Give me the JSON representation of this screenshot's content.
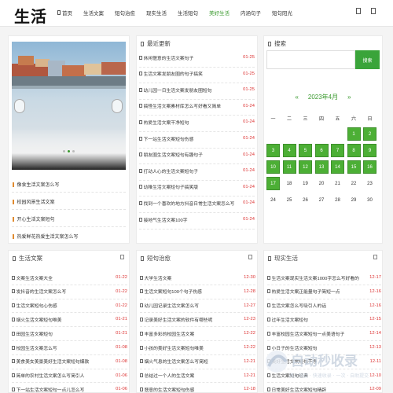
{
  "logo": "生活",
  "nav": [
    {
      "label": "首页",
      "active": false
    },
    {
      "label": "生活文案",
      "active": false
    },
    {
      "label": "短句治愈",
      "active": false
    },
    {
      "label": "现实生活",
      "active": false
    },
    {
      "label": "生活短句",
      "active": false
    },
    {
      "label": "美好生活",
      "active": true
    },
    {
      "label": "内涵句子",
      "active": false
    },
    {
      "label": "短句阳光",
      "active": false
    }
  ],
  "featured": [
    "像食生活文案怎么写",
    "校园风景生活文案",
    "开心生活文案短句",
    "热爱鲜花热爱生活文案怎么写"
  ],
  "latest": {
    "title": "最近更新",
    "rows": [
      {
        "t": "休闲惬意的生活文案句子",
        "d": "01-25"
      },
      {
        "t": "生活文案发朋友圈的句子搞笑",
        "d": "01-25"
      },
      {
        "t": "幼儿园一日生活文案发朋友圈短句",
        "d": "01-25"
      },
      {
        "t": "搞怪生活文案素材库怎么写好看又简单",
        "d": "01-24"
      },
      {
        "t": "热爱生活文案干净短句",
        "d": "01-24"
      },
      {
        "t": "下一站生活文案短句伤感",
        "d": "01-24"
      },
      {
        "t": "朋友圈生活文案短句有趣句子",
        "d": "01-24"
      },
      {
        "t": "打动人心的生活文案短句子",
        "d": "01-24"
      },
      {
        "t": "幼稚生活文案短句子搞笑版",
        "d": "01-24"
      },
      {
        "t": "找到一个喜欢的地方抖音日常生活文案怎么写",
        "d": "01-24"
      },
      {
        "t": "接地气生活文案100字",
        "d": "01-24"
      }
    ]
  },
  "search": {
    "title": "搜索",
    "placeholder": "",
    "button": "搜索"
  },
  "calendar": {
    "prev": "«",
    "title": "2023年4月",
    "next": "»",
    "weekdays": [
      "一",
      "二",
      "三",
      "四",
      "五",
      "六",
      "日"
    ],
    "weeks": [
      [
        "",
        "",
        "",
        "",
        "",
        "1",
        "2"
      ],
      [
        "3",
        "4",
        "5",
        "6",
        "7",
        "8",
        "9"
      ],
      [
        "10",
        "11",
        "12",
        "13",
        "14",
        "15",
        "16"
      ],
      [
        "17",
        "18",
        "19",
        "20",
        "21",
        "22",
        "23"
      ],
      [
        "24",
        "25",
        "26",
        "27",
        "28",
        "29",
        "30"
      ]
    ],
    "highlighted": [
      "1",
      "2",
      "3",
      "4",
      "5",
      "6",
      "7",
      "8",
      "9",
      "10",
      "11",
      "12",
      "13",
      "14",
      "15",
      "16",
      "17"
    ]
  },
  "col1": {
    "title": "生活文案",
    "rows": [
      {
        "t": "文案生活文案大全",
        "d": "01-22"
      },
      {
        "t": "发抖音的生活文案怎么写",
        "d": "01-22"
      },
      {
        "t": "生活文案短句心伤感",
        "d": "01-22"
      },
      {
        "t": "烟火生活文案短句唯美",
        "d": "01-21"
      },
      {
        "t": "田园生活文案短句",
        "d": "01-21"
      },
      {
        "t": "校园生活文案怎么写",
        "d": "01-08"
      },
      {
        "t": "美食美女美景美好生活文案短句爆款",
        "d": "01-08"
      },
      {
        "t": "简单的农村生活文案怎么写简引人",
        "d": "01-06"
      },
      {
        "t": "下一站生活文案短句一点儿怎么写",
        "d": "01-06"
      }
    ]
  },
  "col2": {
    "title": "短句治愈",
    "rows": [
      {
        "t": "大学生活文案",
        "d": "12-30"
      },
      {
        "t": "生活文案短句100个句子伤感",
        "d": "12-28"
      },
      {
        "t": "幼儿园记录生活文案怎么写",
        "d": "12-27"
      },
      {
        "t": "记录美好生活文案的软件有哪些呢",
        "d": "12-23"
      },
      {
        "t": "丰富多彩的校园生活文案",
        "d": "12-22"
      },
      {
        "t": "小孩的美好生活文案短句唯美",
        "d": "12-22"
      },
      {
        "t": "烟火气息的生活文案怎么写简短",
        "d": "12-21"
      },
      {
        "t": "总结过一个人的生活文案",
        "d": "12-21"
      },
      {
        "t": "惬意的生活文案短句伤感",
        "d": "12-18"
      }
    ]
  },
  "col3": {
    "title": "现实生活",
    "rows": [
      {
        "t": "生活文案现实生活文案1000字怎么写好看的",
        "d": "12-17"
      },
      {
        "t": "热爱生活文案正能量句子简短一点",
        "d": "12-16"
      },
      {
        "t": "生活文案怎么写吸引人的话",
        "d": "12-16"
      },
      {
        "t": "过年生活文案短句",
        "d": "12-15"
      },
      {
        "t": "丰富校园生活文案短句一点美语句子",
        "d": "12-14"
      },
      {
        "t": "小日子的生活文案短句",
        "d": "12-13"
      },
      {
        "t": "美好生活文案短句干净",
        "d": "12-11"
      },
      {
        "t": "生活文案短句经典",
        "d": "12-10"
      },
      {
        "t": "日常美好生活文案短句精辟",
        "d": "12-09"
      }
    ]
  },
  "watermark": {
    "main": "自动秒收录",
    "sub": "路上链接 · 快速收录 · 一次 · 自助提交"
  }
}
